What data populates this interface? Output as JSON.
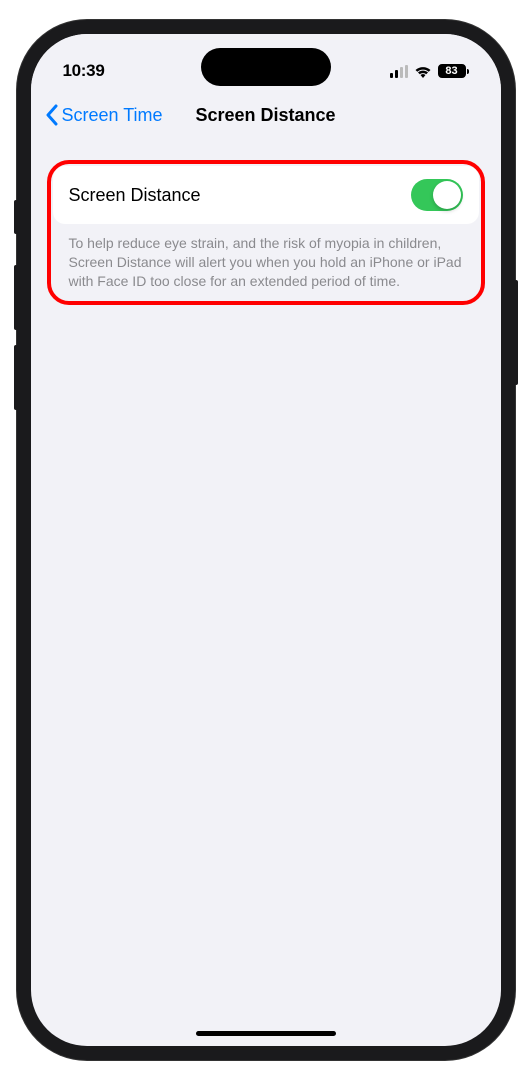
{
  "status": {
    "time": "10:39",
    "battery": "83"
  },
  "nav": {
    "back_label": "Screen Time",
    "title": "Screen Distance"
  },
  "setting": {
    "label": "Screen Distance",
    "toggle_on": true,
    "description": "To help reduce eye strain, and the risk of myopia in children, Screen Distance will alert you when you hold an iPhone or iPad with Face ID too close for an extended period of time."
  }
}
